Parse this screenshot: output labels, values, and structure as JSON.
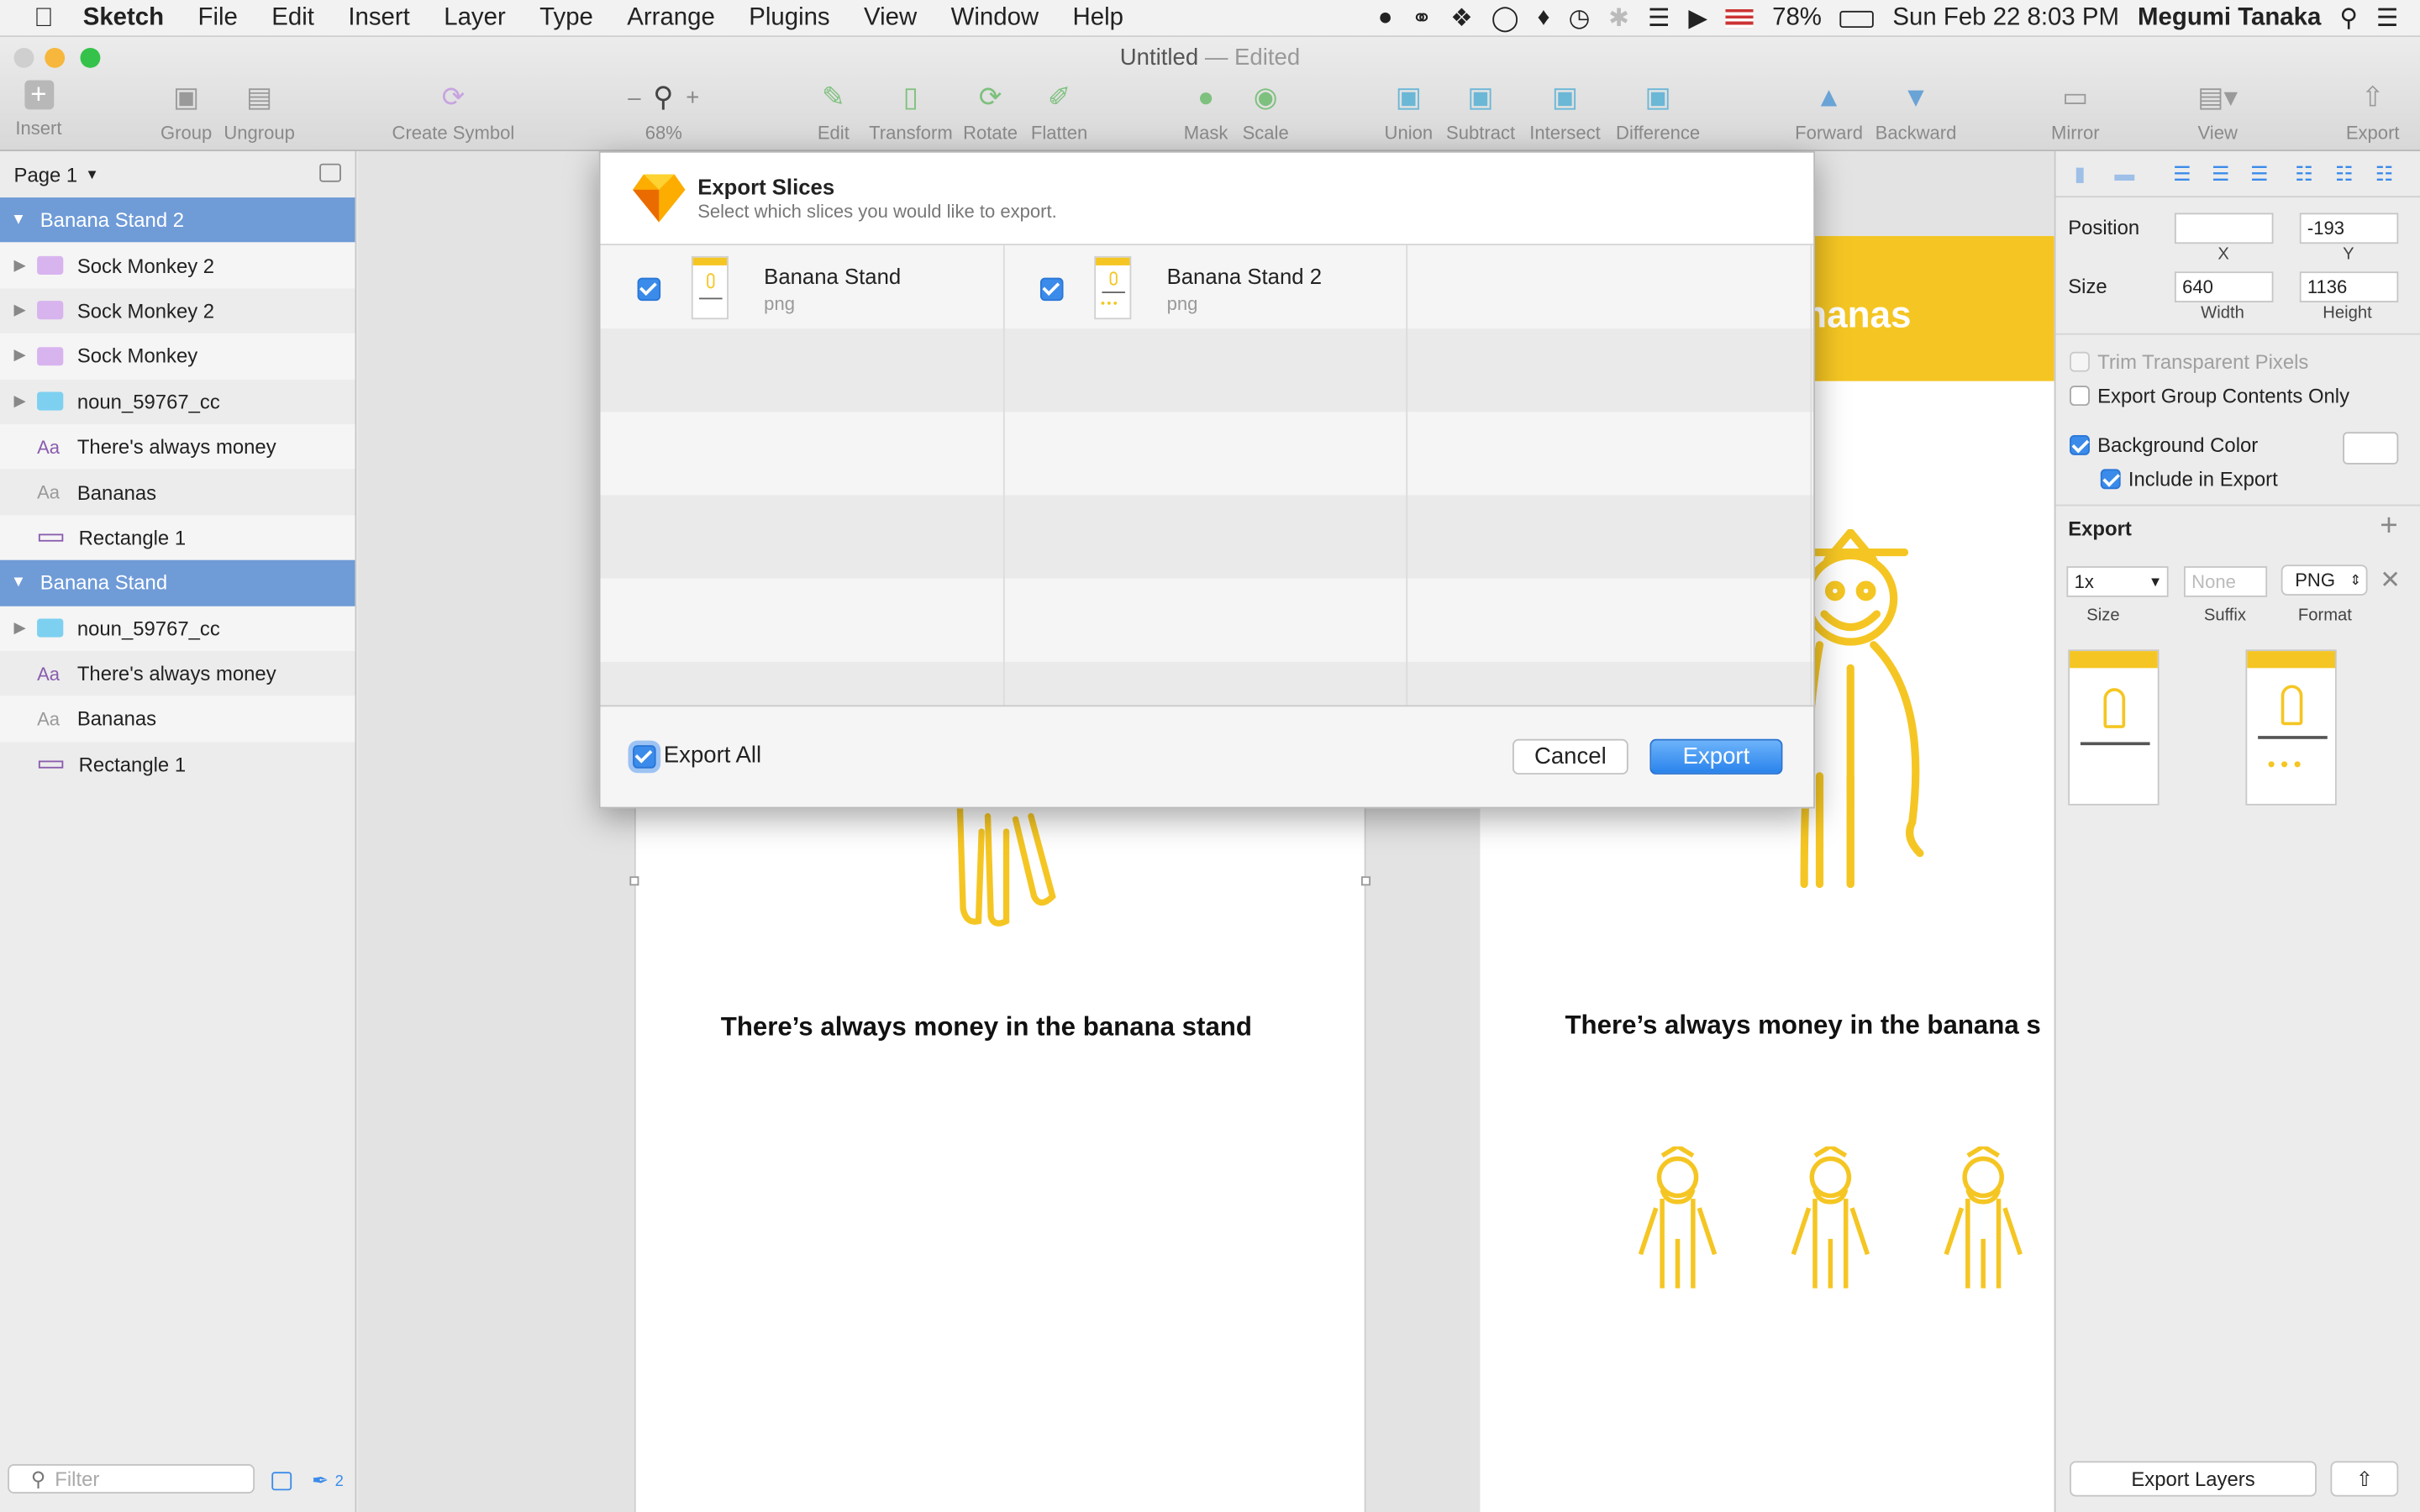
{
  "menubar": {
    "apple": "",
    "app": "Sketch",
    "items": [
      "File",
      "Edit",
      "Insert",
      "Layer",
      "Type",
      "Arrange",
      "Plugins",
      "View",
      "Window",
      "Help"
    ],
    "battery": "78%",
    "datetime": "Sun Feb 22  8:03 PM",
    "user": "Megumi Tanaka"
  },
  "window": {
    "title": "Untitled",
    "edited": "— Edited"
  },
  "toolbar": {
    "insert": "Insert",
    "group": "Group",
    "ungroup": "Ungroup",
    "create_symbol": "Create Symbol",
    "zoom_minus": "–",
    "zoom_plus": "+",
    "zoom": "68%",
    "edit": "Edit",
    "transform": "Transform",
    "rotate": "Rotate",
    "flatten": "Flatten",
    "mask": "Mask",
    "scale": "Scale",
    "union": "Union",
    "subtract": "Subtract",
    "intersect": "Intersect",
    "difference": "Difference",
    "forward": "Forward",
    "backward": "Backward",
    "mirror": "Mirror",
    "view": "View",
    "export": "Export"
  },
  "sidebar": {
    "page": "Page 1",
    "layers": [
      {
        "label": "Banana Stand 2",
        "kind": "artboard"
      },
      {
        "label": "Sock Monkey 2",
        "kind": "folder"
      },
      {
        "label": "Sock Monkey 2",
        "kind": "folder"
      },
      {
        "label": "Sock Monkey",
        "kind": "folder"
      },
      {
        "label": "noun_59767_cc",
        "kind": "folder-blue"
      },
      {
        "label": "There's always money",
        "kind": "text"
      },
      {
        "label": "Bananas",
        "kind": "text-grey"
      },
      {
        "label": "Rectangle 1",
        "kind": "rect"
      },
      {
        "label": "Banana Stand",
        "kind": "artboard"
      },
      {
        "label": "noun_59767_cc",
        "kind": "folder-blue"
      },
      {
        "label": "There's always money",
        "kind": "text"
      },
      {
        "label": "Bananas",
        "kind": "text-grey"
      },
      {
        "label": "Rectangle 1",
        "kind": "rect"
      }
    ],
    "filter_placeholder": "Filter",
    "pages_count": "2"
  },
  "canvas": {
    "headline": "There’s always money in the banana stand",
    "headline2": "There’s always money in the banana s",
    "banner": "nanas"
  },
  "inspector": {
    "position": "Position",
    "x": "",
    "y": "-193",
    "x_cap": "X",
    "y_cap": "Y",
    "size": "Size",
    "width": "640",
    "height": "1136",
    "w_cap": "Width",
    "h_cap": "Height",
    "trim": "Trim Transparent Pixels",
    "group_only": "Export Group Contents Only",
    "bg_color": "Background Color",
    "include": "Include in Export",
    "export": "Export",
    "scale": "1x",
    "suffix_placeholder": "None",
    "format": "PNG",
    "size_cap": "Size",
    "suffix_cap": "Suffix",
    "format_cap": "Format",
    "export_layers": "Export Layers"
  },
  "dialog": {
    "title": "Export Slices",
    "subtitle": "Select which slices you would like to export.",
    "slices": [
      {
        "name": "Banana Stand",
        "type": "png",
        "checked": true
      },
      {
        "name": "Banana Stand 2",
        "type": "png",
        "checked": true
      }
    ],
    "export_all": "Export All",
    "cancel": "Cancel",
    "export": "Export"
  },
  "colors": {
    "accent": "#3b8bea",
    "selection": "#6f9bd7",
    "banana_yellow": "#f5c623"
  }
}
